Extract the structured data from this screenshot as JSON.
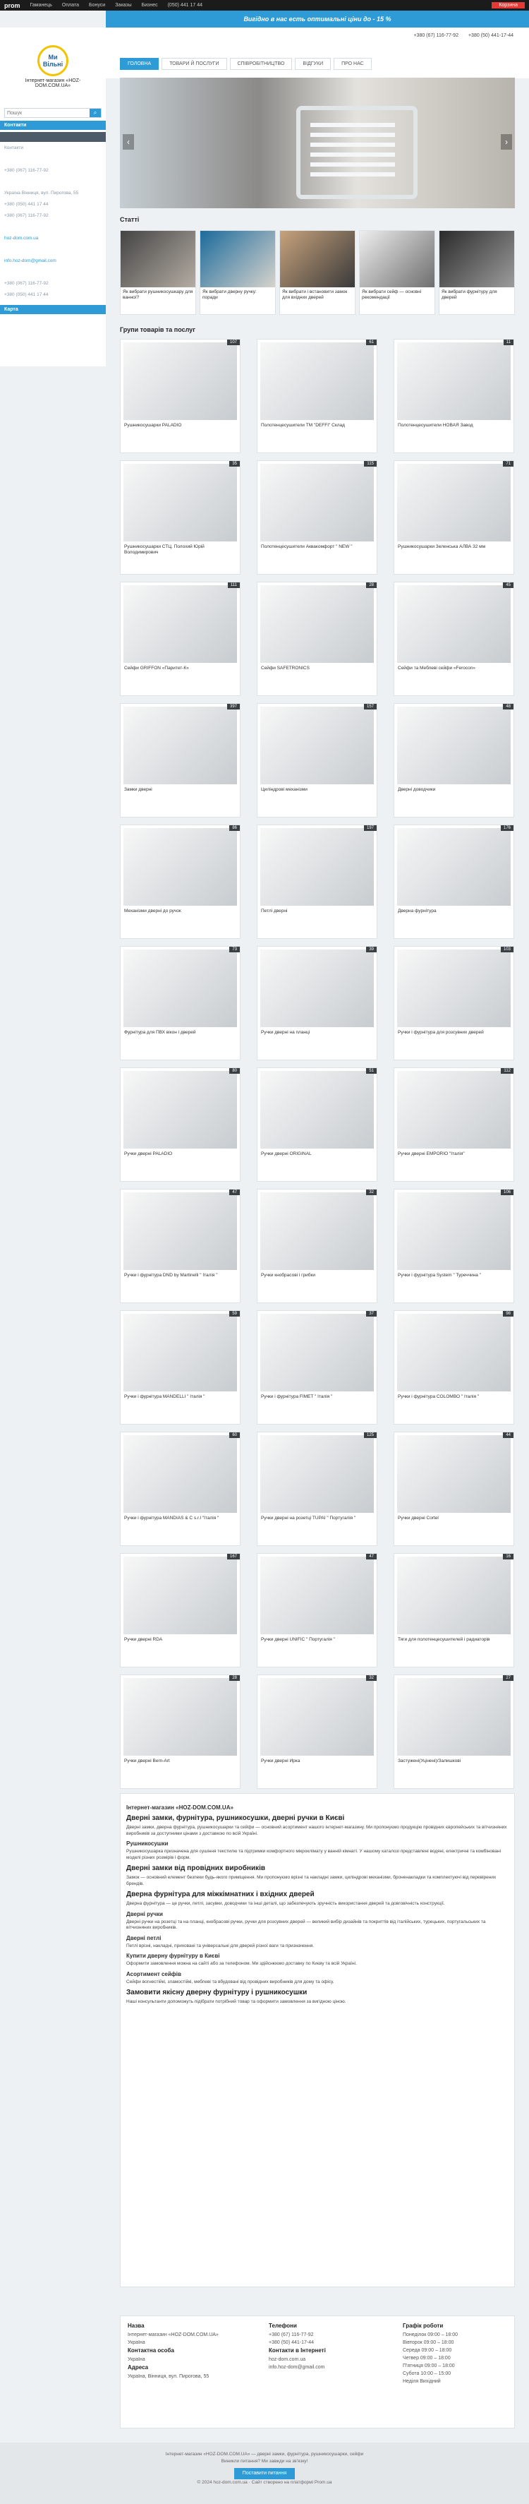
{
  "topbar": {
    "logo": "prom",
    "items": [
      "Гаманець",
      "Оплата",
      "Бонуси",
      "Заказы",
      "Бизнес"
    ],
    "phone": "(050) 441 17 44",
    "cart": "Корзина"
  },
  "promo": "Вигідно в нас есть оптимальні ціни до - 15 %",
  "brand": {
    "name": "Ми Вільні",
    "tagline": "Інтернет-магазин «HOZ-DOM.COM.UA»"
  },
  "search": {
    "placeholder": "Пошук"
  },
  "sidebar": {
    "contacts_head": "Контакти",
    "lines": [
      "Контакти",
      "",
      "+380 (067) 116-77-92",
      "",
      "Україна Вінниця, вул. Пирогова, 55",
      "+380 (050) 441 17 44",
      "+380 (067) 116-77-92",
      "",
      "hoz-dom.com.ua",
      "",
      "info.hoz-dom@gmail.com",
      "",
      "+380 (067) 116-77-92",
      "+380 (050) 441 17 44"
    ],
    "map_label": "Карта"
  },
  "header": {
    "contacts": [
      "+380 (67) 116-77-92",
      "+380 (50) 441-17-44"
    ]
  },
  "menu": [
    "ГОЛОВНА",
    "ТОВАРИ Й ПОСЛУГИ",
    "СПІВРОБІТНИЦТВО",
    "ВІДГУКИ",
    "ПРО НАС"
  ],
  "sections": {
    "articles": "Статті",
    "groups": "Групи товарів та послуг"
  },
  "articles": [
    "Як вибрати рушникосушкару для ванної?",
    "Як вибрати дверну ручку: поради",
    "Як вибрати і встановити замок для вхідних дверей",
    "Як вибрати сейф — основні рекомендації",
    "Як вибрати фурнітуру для дверей"
  ],
  "categories": [
    {
      "label": "Рушникосушарки PALADIO",
      "count": "107"
    },
    {
      "label": "Полотенцесушители ТМ \"DEFFI\" Склад",
      "count": "61"
    },
    {
      "label": "Полотенцесушители НОВАЯ Завод",
      "count": "11"
    },
    {
      "label": "Рушникосушарки СТЦ. Полохий Юрій Володимирович",
      "count": "35"
    },
    {
      "label": "Полотенцесушители Аквакомфорт \" NEW \"",
      "count": "115"
    },
    {
      "label": "Рушникосушарки Зеленська АЛВА 32 мм",
      "count": "71"
    },
    {
      "label": "Сейфи GRIFFON «Паритет-К»",
      "count": "111"
    },
    {
      "label": "Сейфи SAFETRONICS",
      "count": "28"
    },
    {
      "label": "Сейфи та Меблеві сейфи «Ferocon»",
      "count": "45"
    },
    {
      "label": "Замки дверні",
      "count": "397"
    },
    {
      "label": "Циліндрові механізми",
      "count": "157"
    },
    {
      "label": "Дверні доводчики",
      "count": "48"
    },
    {
      "label": "Механізми дверні до ручок",
      "count": "86"
    },
    {
      "label": "Петлі дверні",
      "count": "197"
    },
    {
      "label": "Дверна фурнітура",
      "count": "176"
    },
    {
      "label": "Фурнітура для ПВХ вікон і дверей",
      "count": "73"
    },
    {
      "label": "Ручки дверні на планці",
      "count": "39"
    },
    {
      "label": "Ручки і фурнітура для розсувних дверей",
      "count": "103"
    },
    {
      "label": "Ручки дверні PALADIO",
      "count": "80"
    },
    {
      "label": "Ручки дверні ORIGINAL",
      "count": "51"
    },
    {
      "label": "Ручки дверні EMPORIO \"Італія\"",
      "count": "112"
    },
    {
      "label": "Ручки і фурнітура DND by Martinelli \" Італія \"",
      "count": "47"
    },
    {
      "label": "Ручки кнобрасові і грибки",
      "count": "32"
    },
    {
      "label": "Ручки і фурнітура System \" Туреччина \"",
      "count": "106"
    },
    {
      "label": "Ручки і фурнітура MANDELLI \" Італія \"",
      "count": "59"
    },
    {
      "label": "Ручки і фурнітура FIMET \" Італія \"",
      "count": "37"
    },
    {
      "label": "Ручки і фурнітура COLOMBO \" Італія \"",
      "count": "98"
    },
    {
      "label": "Ручки і фурнітура MANDIAS & C s.r.l \"Італія \"",
      "count": "60"
    },
    {
      "label": "Ручки дверні на розетці TUPAI \" Португалія \"",
      "count": "125"
    },
    {
      "label": "Ручки дверні Cortel",
      "count": "44"
    },
    {
      "label": "Ручки дверні RDA",
      "count": "167"
    },
    {
      "label": "Ручки дверні UNIFIC \" Португалія \"",
      "count": "47"
    },
    {
      "label": "Тяги для полотенцесушителей і радиаторів",
      "count": "16"
    },
    {
      "label": "Ручки дверні Bern-Art",
      "count": "28"
    },
    {
      "label": "Ручки дверні Ирка",
      "count": "32"
    },
    {
      "label": "Застужені(Уцінені)/Залишкові",
      "count": "27"
    }
  ],
  "about": {
    "title": "Інтернет-магазин «HOZ-DOM.COM.UA»",
    "h1": "Дверні замки, фурнітура, рушникосушки, дверні ручки в Києві",
    "p1": "Дверні замки, дверна фурнітура, рушникосушарки та сейфи — основний асортимент нашого інтернет-магазину. Ми пропонуємо продукцію провідних європейських та вітчизняних виробників за доступними цінами з доставкою по всій Україні.",
    "h2": "Рушникосушки",
    "p2": "Рушникосушарка призначена для сушіння текстилю та підтримки комфортного мікроклімату у ванній кімнаті. У нашому каталозі представлені водяні, електричні та комбіновані моделі різних розмірів і форм.",
    "h3": "Дверні замки від провідних виробників",
    "p3": "Замок — основний елемент безпеки будь-якого приміщення. Ми пропонуємо врізні та накладні замки, циліндрові механізми, броненакладки та комплектуючі від перевірених брендів.",
    "h4": "Дверна фурнітура для міжкімнатних і вхідних дверей",
    "p4": "Дверна фурнітура — це ручки, петлі, засувки, доводчики та інші деталі, що забезпечують зручність використання дверей та довговічність конструкції.",
    "h5": "Дверні ручки",
    "p5": "Дверні ручки на розетці та на планці, кнобрасові ручки, ручки для розсувних дверей — великий вибір дизайнів та покриттів від італійських, турецьких, португальських та вітчизняних виробників.",
    "h6": "Дверні петлі",
    "p6": "Петлі врізні, накладні, приховані та універсальні для дверей різної ваги та призначення.",
    "h7": "Купити дверну фурнітуру в Києві",
    "p7": "Оформити замовлення можна на сайті або за телефоном. Ми здійснюємо доставку по Києву та всій Україні.",
    "h8": "Асортимент сейфів",
    "p8": "Сейфи вогнестійкі, зламостійкі, меблеві та вбудовані від провідних виробників для дому та офісу.",
    "h9": "Замовити якісну дверну фурнітуру і рушникосушки",
    "p9": "Наші консультанти допоможуть підібрати потрібний товар та оформити замовлення за вигідною ціною."
  },
  "footer": {
    "nav_head": "Назва",
    "nav": [
      "Інтернет-магазин «HOZ-DOM.COM.UA»",
      "Україна"
    ],
    "contact_head": "Контактна особа",
    "contact": "Україна",
    "address_head": "Адреса",
    "address": "Україна, Вінниця, вул. Пирогова, 55",
    "phones_head": "Телефони",
    "phones": [
      "+380 (67) 116-77-92",
      "+380 (50) 441-17-44"
    ],
    "web_head": "Контакти в Інтернеті",
    "web": [
      "hoz-dom.com.ua",
      "info.hoz-dom@gmail.com"
    ],
    "hours_head": "Графік роботи",
    "hours": [
      "Понеділок 09:00 – 18:00",
      "Вівторок 09:00 – 18:00",
      "Середа 09:00 – 18:00",
      "Четвер 09:00 – 18:00",
      "П'ятниця 09:00 – 18:00",
      "Субота 10:00 – 15:00",
      "Неділя Вихідний"
    ]
  },
  "bottom": {
    "line1": "Інтернет-магазин «HOZ-DOM.COM.UA» — дверні замки, фурнітура, рушникосушарки, сейфи",
    "question": "Виникли питання? Ми завжди на зв'язку!",
    "btn": "Поставити питання",
    "line2": "© 2024 hoz-dom.com.ua · Сайт створено на платформі Prom.ua"
  }
}
